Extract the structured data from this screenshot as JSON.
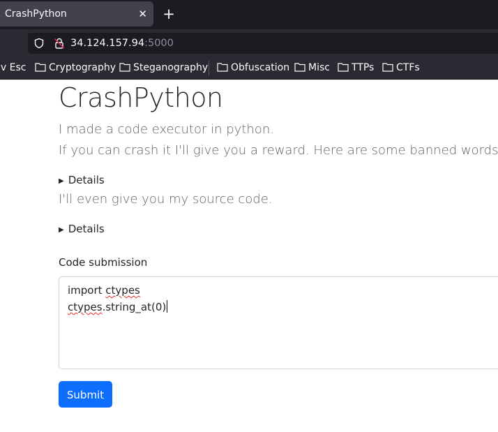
{
  "browser": {
    "tab": {
      "title": "CrashPython",
      "close_glyph": "✕"
    },
    "new_tab_glyph": "+",
    "url": {
      "host": "34.124.157.94",
      "port": ":5000"
    },
    "bookmarks": [
      {
        "label": "iv Esc",
        "folder": false
      },
      {
        "label": "Cryptography",
        "folder": true
      },
      {
        "label": "Steganography",
        "folder": true
      },
      {
        "label": "Obfuscation",
        "folder": true
      },
      {
        "label": "Misc",
        "folder": true
      },
      {
        "label": "TTPs",
        "folder": true
      },
      {
        "label": "CTFs",
        "folder": true
      }
    ]
  },
  "page": {
    "title": "CrashPython",
    "lead1": "I made a code executor in python.",
    "lead2": "If you can crash it I'll give you a reward. Here are some banned words.",
    "details1": "Details",
    "lead3": "I'll even give you my source code.",
    "details2": "Details",
    "form": {
      "label": "Code submission",
      "code": {
        "line1_a": "import ",
        "line1_b": "ctypes",
        "line2_a": "ctypes",
        "line2_b": ".string_at(0)"
      },
      "submit_label": "Submit"
    }
  },
  "colors": {
    "accent": "#0d6efd",
    "chrome_dark": "#1c1b22",
    "chrome_mid": "#2b2a33",
    "spell_error": "#e2231a"
  }
}
